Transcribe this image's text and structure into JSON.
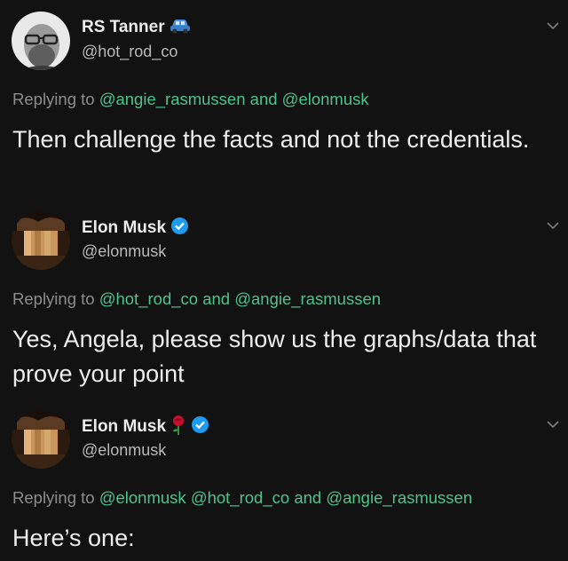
{
  "tweets": [
    {
      "name": "RS Tanner",
      "handle": "@hot_rod_co",
      "reply_prefix": "Replying to",
      "mention_1": "@angie_rasmussen",
      "joiner": "and",
      "mention_2": "@elonmusk",
      "text": "Then challenge the facts and not the credentials.",
      "badge_icon": "car-emoji-icon"
    },
    {
      "name": "Elon Musk",
      "handle": "@elonmusk",
      "reply_prefix": "Replying to",
      "mention_1": "@hot_rod_co",
      "joiner": "and",
      "mention_2": "@angie_rasmussen",
      "text": "Yes, Angela, please show us the graphs/data that prove your point",
      "badge_icon": "verified-badge-icon"
    },
    {
      "name": "Elon Musk",
      "handle": "@elonmusk",
      "reply_prefix": "Replying to",
      "mention_1": "@elonmusk",
      "mention_2": "@hot_rod_co",
      "joiner": "and",
      "mention_3": "@angie_rasmussen",
      "text": "Here’s one:",
      "badge_icons": [
        "rose-emoji-icon",
        "verified-badge-icon"
      ]
    }
  ],
  "colors": {
    "background": "#121212",
    "mention": "#4fc38c",
    "verified": "#1d9bf0",
    "muted": "#8c8c8c"
  }
}
